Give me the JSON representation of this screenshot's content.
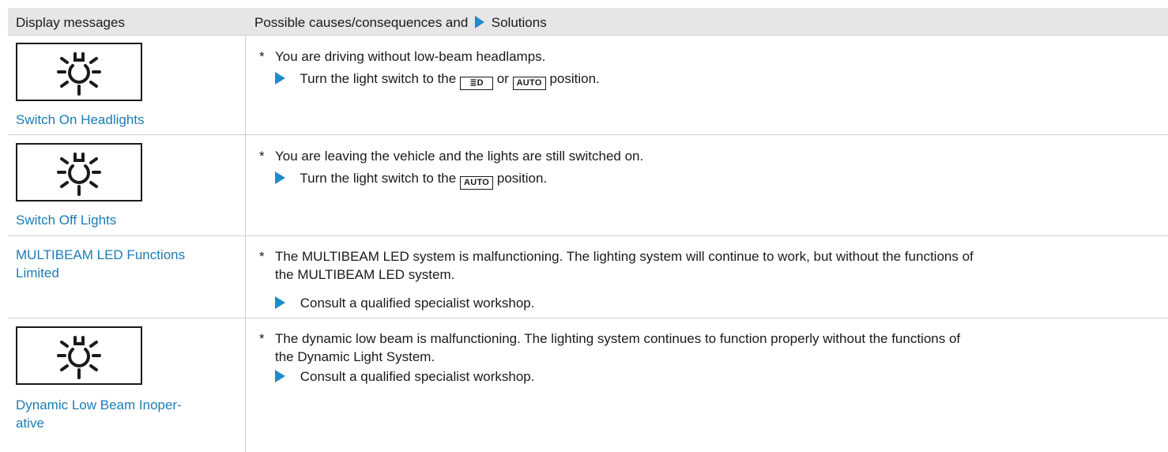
{
  "header": {
    "col1": "Display messages",
    "col2_prefix": "Possible causes/consequences and",
    "col2_suffix": "Solutions"
  },
  "rows": [
    {
      "message": "Switch On Headlights",
      "cause": "You are driving without low-beam headlamps.",
      "solution_prefix": "Turn the light switch to the",
      "solution_key1": "≣D",
      "solution_or": "or",
      "solution_key2": "AUTO",
      "solution_suffix": "position."
    },
    {
      "message": "Switch Off Lights",
      "cause": "You are leaving the vehicle and the lights are still switched on.",
      "solution_prefix": "Turn the light switch to the",
      "solution_key": "AUTO",
      "solution_suffix": "position."
    },
    {
      "message_line1": "MULTIBEAM LED Functions",
      "message_line2": "Limited",
      "cause_line1": "The MULTIBEAM LED system is malfunctioning. The lighting system will continue to work, but without the functions of",
      "cause_line2": "the MULTIBEAM LED system.",
      "solution": "Consult a qualified specialist workshop."
    },
    {
      "message_line1": "Dynamic Low Beam Inoper-",
      "message_line2": "ative",
      "cause_line1": "The dynamic low beam is malfunctioning. The lighting system continues to function properly without the functions of",
      "cause_line2": "the Dynamic Light System.",
      "solution": "Consult a qualified specialist workshop."
    }
  ],
  "symbols": {
    "bullet": "*",
    "icon": "headlight-bulb-icon"
  },
  "colors": {
    "accent": "#1e8ccc",
    "message_text": "#1b7cb5",
    "header_bg": "#e6e6e6"
  }
}
